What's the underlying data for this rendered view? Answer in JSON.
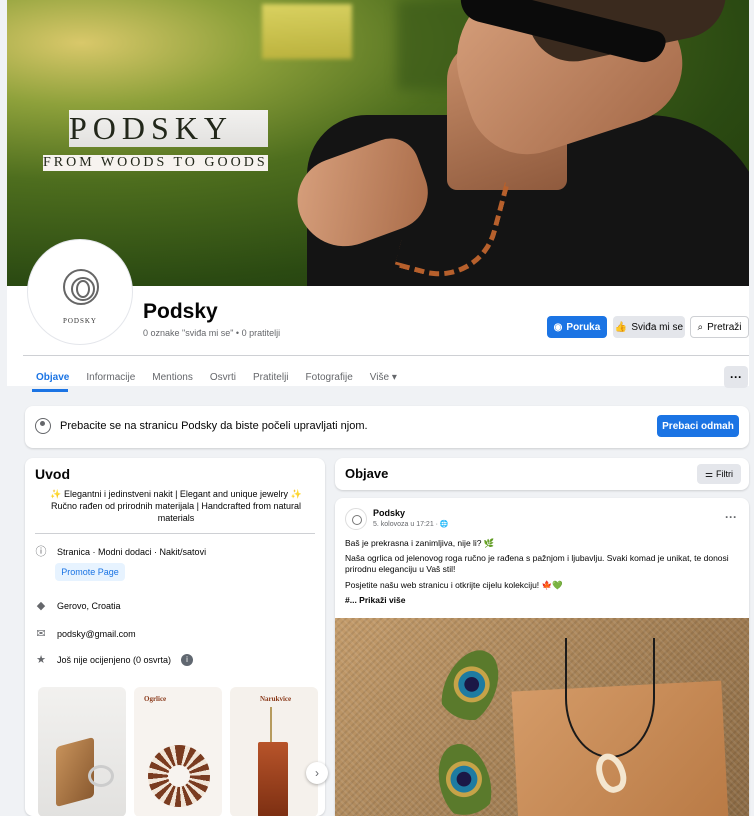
{
  "cover": {
    "brand_title": "PODSKY",
    "brand_tagline": "FROM WOODS TO GOODS"
  },
  "profile": {
    "avatar_text": "PODSKY",
    "name": "Podsky",
    "stats": "0 oznake \"sviđa mi se\" • 0 pratitelji"
  },
  "actions": {
    "message": "Poruka",
    "like": "Sviđa mi se",
    "search": "Pretraži"
  },
  "tabs": [
    {
      "label": "Objave",
      "active": true
    },
    {
      "label": "Informacije"
    },
    {
      "label": "Mentions"
    },
    {
      "label": "Osvrti"
    },
    {
      "label": "Pratitelji"
    },
    {
      "label": "Fotografije"
    },
    {
      "label": "Više ▾"
    }
  ],
  "more_button": "···",
  "switch_banner": {
    "text": "Prebacite se na stranicu Podsky da biste počeli upravljati njom.",
    "button": "Prebaci odmah"
  },
  "intro": {
    "title": "Uvod",
    "bio_line1": "✨ Elegantni i jedinstveni nakit | Elegant and unique jewelry ✨",
    "bio_line2": "Ručno rađen od prirodnih materijala | Handcrafted from natural",
    "bio_line3": "materials",
    "category": "Stranica · Modni dodaci · Nakit/satovi",
    "promote": "Promote Page",
    "location": "Gerovo, Croatia",
    "email": "podsky@gmail.com",
    "rating": "Još nije ocijenjeno (0 osvrta)",
    "thumb_labels": [
      "",
      "Ogrlice",
      "Narukvice"
    ]
  },
  "posts": {
    "title": "Objave",
    "filter": "Filtri",
    "post": {
      "author": "Podsky",
      "date": "5. kolovoza u 17:21 · 🌐",
      "line1": "Baš je prekrasna i zanimljiva, nije li? 🌿",
      "line2": "Naša ogrlica od jelenovog roga ručno je rađena s pažnjom i ljubavlju. Svaki komad je unikat, te donosi prirodnu eleganciju u Vaš stil!",
      "line3": "Posjetite našu web stranicu i otkrijte cijelu kolekciju! 🍁💚",
      "more": "#... Prikaži više"
    }
  },
  "colors": {
    "accent": "#1b74e4",
    "background": "#f0f2f5",
    "surface": "#ffffff"
  }
}
